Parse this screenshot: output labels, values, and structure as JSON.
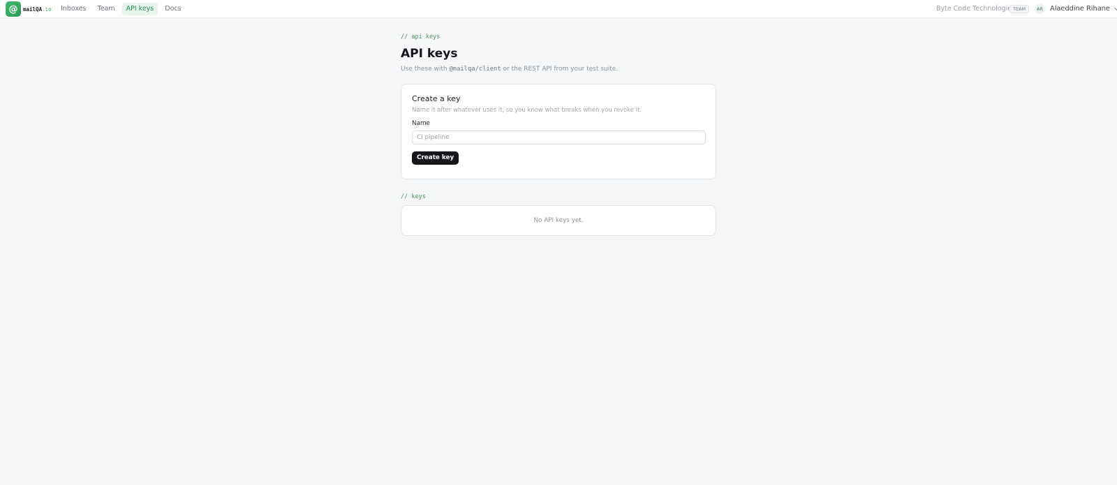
{
  "header": {
    "brand": {
      "name": "mailQA",
      "tld": ".io"
    },
    "nav": [
      {
        "label": "Inboxes",
        "active": false
      },
      {
        "label": "Team",
        "active": false
      },
      {
        "label": "API keys",
        "active": true
      },
      {
        "label": "Docs",
        "active": false
      }
    ],
    "org_name": "Byte Code Technologie",
    "org_badge": "TEAM",
    "user": {
      "initials": "AR",
      "name": "Alaeddine Rihane"
    }
  },
  "page": {
    "eyebrow": "// api keys",
    "title": "API keys",
    "subtitle_prefix": "Use these with ",
    "subtitle_code": "@mailqa/client",
    "subtitle_suffix": " or the REST API from your test suite."
  },
  "create_key": {
    "title": "Create a key",
    "description": "Name it after whatever uses it, so you know what breaks when you revoke it.",
    "name_label": "Name",
    "name_value": "",
    "name_placeholder": "CI pipeline",
    "button_label": "Create key"
  },
  "keys": {
    "eyebrow": "// keys",
    "empty_text": "No API keys yet."
  },
  "colors": {
    "brand": "#35a963",
    "active_nav_bg": "#e8f5ec",
    "button_bg": "#15171a"
  },
  "icons": {
    "brand": "at-sign-icon",
    "user_menu": "chevron-down-icon"
  }
}
